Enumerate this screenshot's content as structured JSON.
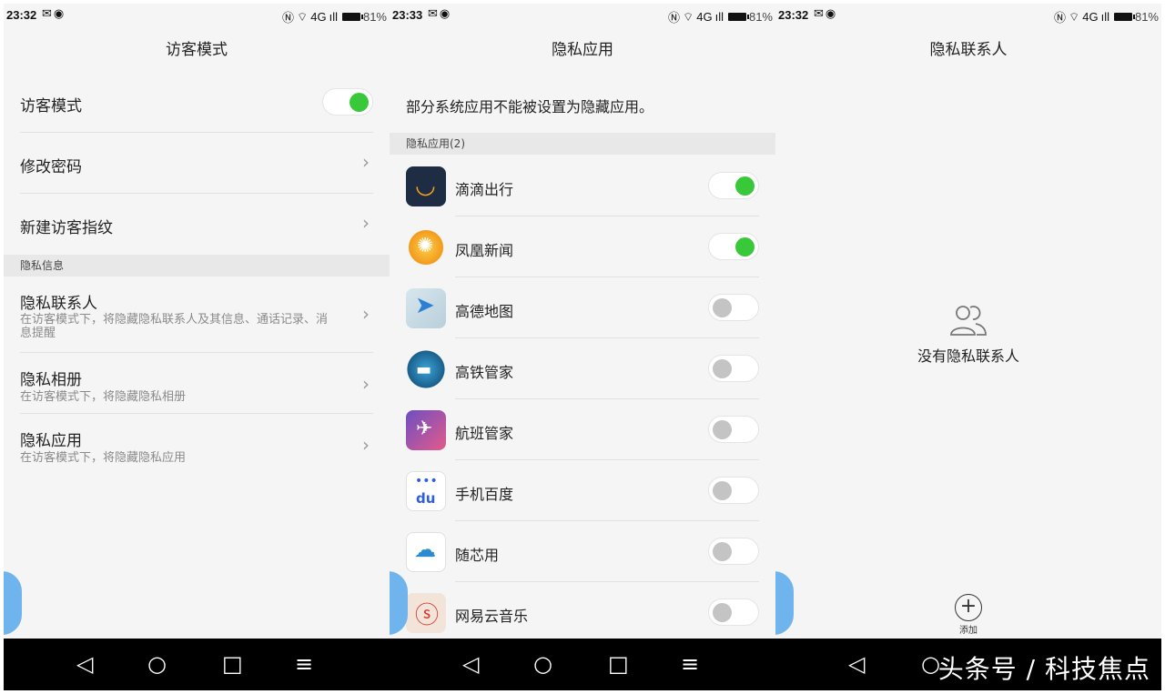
{
  "screens": [
    {
      "status": {
        "time": "23:32",
        "battery": "81%",
        "network": "4G"
      },
      "title": "访客模式",
      "rows": [
        {
          "title": "访客模式",
          "toggle": true
        },
        {
          "title": "修改密码"
        },
        {
          "title": "新建访客指纹"
        }
      ],
      "section_header": "隐私信息",
      "info_rows": [
        {
          "title": "隐私联系人",
          "sub": "在访客模式下，将隐藏隐私联系人及其信息、通话记录、消息提醒"
        },
        {
          "title": "隐私相册",
          "sub": "在访客模式下，将隐藏隐私相册"
        },
        {
          "title": "隐私应用",
          "sub": "在访客模式下，将隐藏隐私应用"
        }
      ]
    },
    {
      "status": {
        "time": "23:33",
        "battery": "81%",
        "network": "4G"
      },
      "title": "隐私应用",
      "notice": "部分系统应用不能被设置为隐藏应用。",
      "section_header": "隐私应用(2)",
      "apps": [
        {
          "name": "滴滴出行",
          "on": true,
          "icon": "didi-icon"
        },
        {
          "name": "凤凰新闻",
          "on": true,
          "icon": "ifeng-icon"
        },
        {
          "name": "高德地图",
          "on": false,
          "icon": "amap-icon"
        },
        {
          "name": "高铁管家",
          "on": false,
          "icon": "train-icon"
        },
        {
          "name": "航班管家",
          "on": false,
          "icon": "flight-icon"
        },
        {
          "name": "手机百度",
          "on": false,
          "icon": "baidu-icon"
        },
        {
          "name": "随芯用",
          "on": false,
          "icon": "cloud-icon"
        },
        {
          "name": "网易云音乐",
          "on": false,
          "icon": "netease-music-icon"
        }
      ]
    },
    {
      "status": {
        "time": "23:32",
        "battery": "81%",
        "network": "4G"
      },
      "title": "隐私联系人",
      "empty_text": "没有隐私联系人",
      "add_label": "添加"
    }
  ],
  "navbar": {
    "back": "◁",
    "home": "○",
    "recents": "□",
    "menu": "≡"
  },
  "watermark": "头条号 / 科技焦点"
}
